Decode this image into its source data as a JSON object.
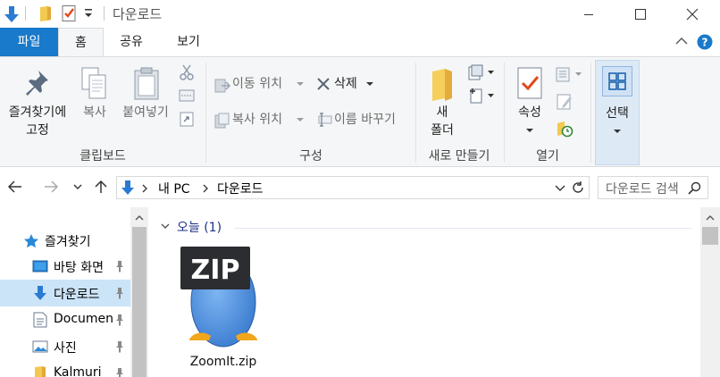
{
  "window": {
    "title": "다운로드",
    "controls": {
      "minimize": "minimize",
      "maximize": "maximize",
      "close": "close"
    }
  },
  "ribbon": {
    "tabs": [
      "파일",
      "홈",
      "공유",
      "보기"
    ],
    "active_tab": "홈",
    "groups": {
      "clipboard": {
        "label": "클립보드",
        "pin": [
          "즐겨찾기에",
          "고정"
        ],
        "copy": "복사",
        "paste": "붙여넣기"
      },
      "organize": {
        "label": "구성",
        "move_to": "이동 위치",
        "copy_to": "복사 위치",
        "delete": "삭제",
        "rename": "이름 바꾸기"
      },
      "new": {
        "label": "새로 만들기",
        "new_folder": [
          "새",
          "폴더"
        ]
      },
      "open": {
        "label": "열기",
        "properties": "속성"
      },
      "select": {
        "select": "선택"
      }
    }
  },
  "address": {
    "path": [
      "내 PC",
      "다운로드"
    ],
    "search_placeholder": "다운로드 검색"
  },
  "nav_pane": {
    "quick_access": "즐겨찾기",
    "items": [
      {
        "label": "바탕 화면",
        "pinned": true,
        "icon": "desktop-icon"
      },
      {
        "label": "다운로드",
        "pinned": true,
        "icon": "download-icon",
        "selected": true
      },
      {
        "label": "Documents",
        "pinned": true,
        "icon": "document-icon"
      },
      {
        "label": "사진",
        "pinned": true,
        "icon": "pictures-icon"
      },
      {
        "label": "Kalmuri",
        "pinned": true,
        "icon": "folder-icon"
      }
    ]
  },
  "content": {
    "group_header": "오늘 (1)",
    "files": [
      {
        "name": "ZoomIt.zip",
        "icon_badge": "ZIP"
      }
    ]
  },
  "colors": {
    "accent": "#1979ca",
    "selection": "#cce4f7",
    "group_header": "#1e3287"
  }
}
